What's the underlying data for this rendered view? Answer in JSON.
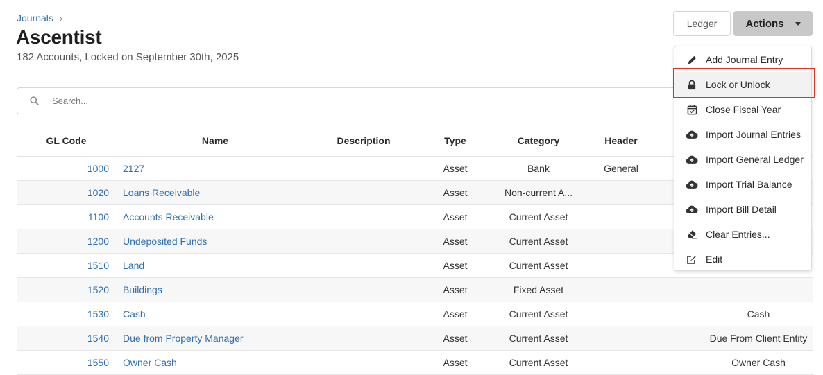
{
  "breadcrumb": {
    "parent": "Journals",
    "separator": "›"
  },
  "header": {
    "title": "Ascentist",
    "subtitle": "182 Accounts, Locked on September 30th, 2025",
    "ledger_label": "Ledger",
    "actions_label": "Actions"
  },
  "search": {
    "placeholder": "Search...",
    "value": ""
  },
  "table": {
    "columns": [
      "GL Code",
      "Name",
      "Description",
      "Type",
      "Category",
      "Header",
      ""
    ],
    "rows": [
      {
        "gl": "1000",
        "name": "2127",
        "desc": "",
        "type": "Asset",
        "category": "Bank",
        "header": "General",
        "extra": ""
      },
      {
        "gl": "1020",
        "name": "Loans Receivable",
        "desc": "",
        "type": "Asset",
        "category": "Non-current A...",
        "header": "",
        "extra": ""
      },
      {
        "gl": "1100",
        "name": "Accounts Receivable",
        "desc": "",
        "type": "Asset",
        "category": "Current Asset",
        "header": "",
        "extra": ""
      },
      {
        "gl": "1200",
        "name": "Undeposited Funds",
        "desc": "",
        "type": "Asset",
        "category": "Current Asset",
        "header": "",
        "extra": ""
      },
      {
        "gl": "1510",
        "name": "Land",
        "desc": "",
        "type": "Asset",
        "category": "Current Asset",
        "header": "",
        "extra": ""
      },
      {
        "gl": "1520",
        "name": "Buildings",
        "desc": "",
        "type": "Asset",
        "category": "Fixed Asset",
        "header": "",
        "extra": ""
      },
      {
        "gl": "1530",
        "name": "Cash",
        "desc": "",
        "type": "Asset",
        "category": "Current Asset",
        "header": "",
        "extra": "Cash"
      },
      {
        "gl": "1540",
        "name": "Due from Property Manager",
        "desc": "",
        "type": "Asset",
        "category": "Current Asset",
        "header": "",
        "extra": "Due From Client Entity"
      },
      {
        "gl": "1550",
        "name": "Owner Cash",
        "desc": "",
        "type": "Asset",
        "category": "Current Asset",
        "header": "",
        "extra": "Owner Cash"
      }
    ]
  },
  "actions_menu": {
    "items": [
      {
        "label": "Add Journal Entry",
        "icon": "pencil-icon"
      },
      {
        "label": "Lock or Unlock",
        "icon": "lock-icon"
      },
      {
        "label": "Close Fiscal Year",
        "icon": "calendar-check-icon"
      },
      {
        "label": "Import Journal Entries",
        "icon": "cloud-upload-icon"
      },
      {
        "label": "Import General Ledger",
        "icon": "cloud-upload-icon"
      },
      {
        "label": "Import Trial Balance",
        "icon": "cloud-upload-icon"
      },
      {
        "label": "Import Bill Detail",
        "icon": "cloud-upload-icon"
      },
      {
        "label": "Clear Entries...",
        "icon": "eraser-icon"
      },
      {
        "label": "Edit",
        "icon": "edit-icon"
      }
    ],
    "highlighted_item": "Lock or Unlock",
    "highlight_color": "#e0321f"
  },
  "colors": {
    "link": "#2f6fb3",
    "actions_button": "#c8c8c8"
  }
}
